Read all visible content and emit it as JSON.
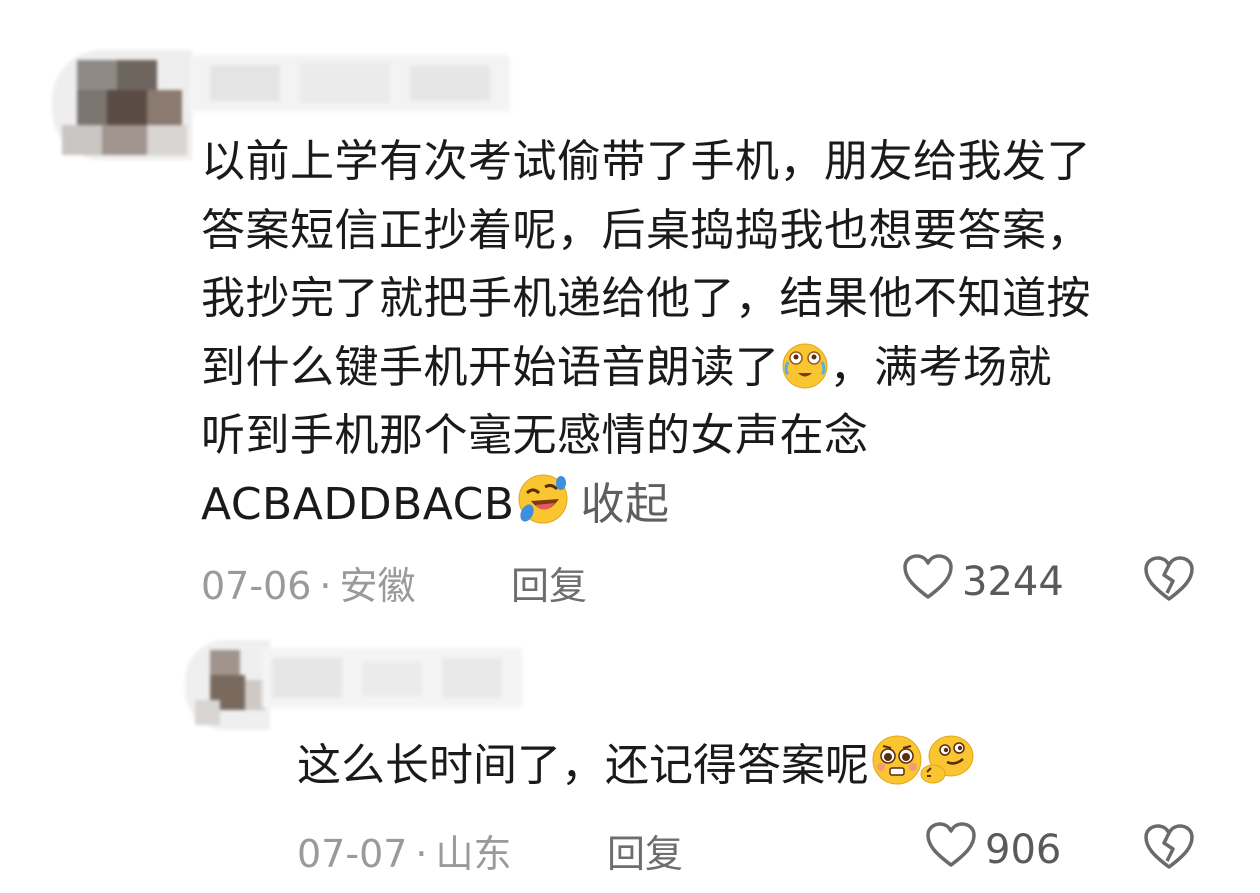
{
  "comment": {
    "lines": [
      "以前上学有次考试偷带了手机，朋友给我发了",
      "答案短信正抄着呢，后桌捣捣我也想要答案，",
      "我抄完了就把手机递给他了，结果他不知道按",
      "到什么键手机开始语音朗读了",
      "，满考场就",
      "听到手机那个毫无感情的女声在念",
      "ACBADDBACB"
    ],
    "collapse_label": "收起",
    "date": "07-06",
    "separator": "·",
    "location": "安徽",
    "reply_label": "回复",
    "likes": "3244"
  },
  "reply": {
    "text": "这么长时间了，还记得答案呢",
    "date": "07-07",
    "separator": "·",
    "location": "山东",
    "reply_label": "回复",
    "likes": "906"
  },
  "icons": {
    "emoji_crying_laugh": "crying-laughing-emoji",
    "emoji_rofl": "rolling-laughing-emoji",
    "emoji_pleading": "pleading-emoji",
    "emoji_smirk": "thinking-smirk-emoji",
    "like": "heart-outline-icon",
    "dislike": "broken-heart-icon"
  },
  "colors": {
    "text": "#1a1a1a",
    "meta": "#9a9a9a",
    "emoji_yellow": "#f9c531"
  }
}
